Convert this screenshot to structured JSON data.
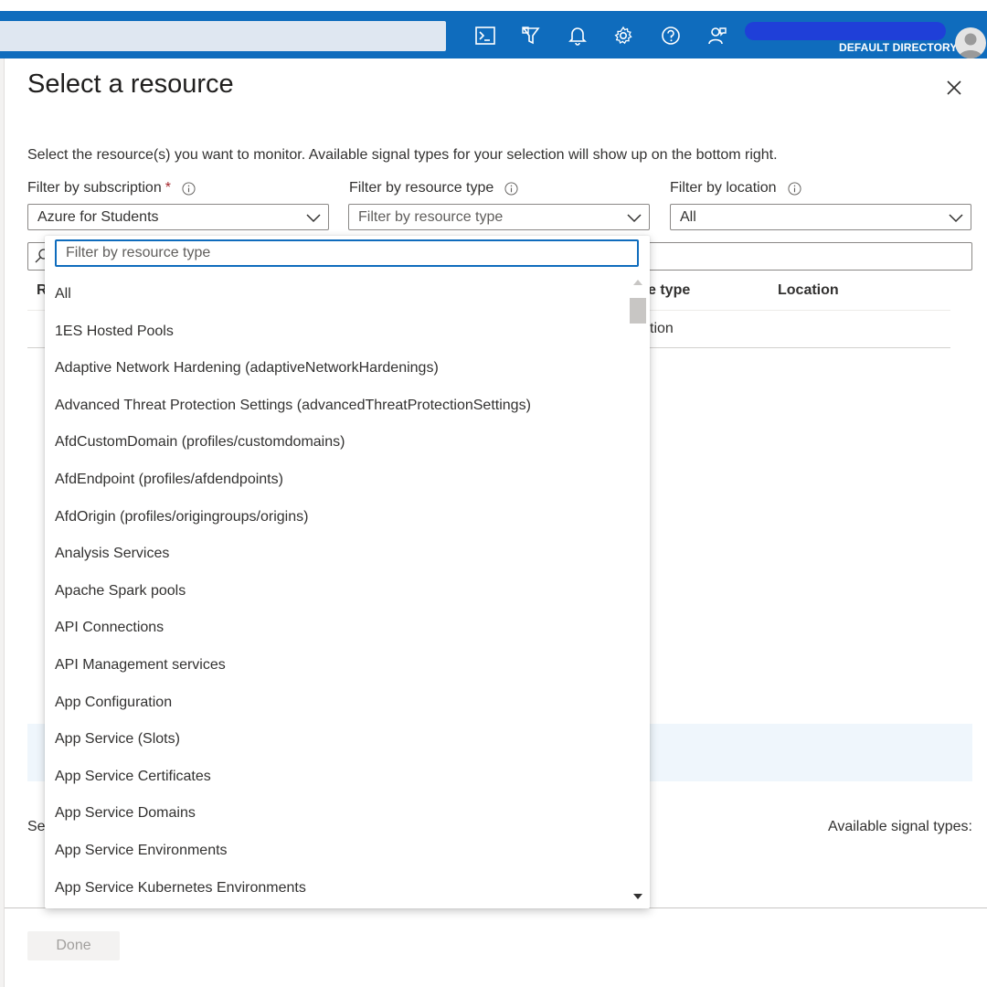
{
  "topbar": {
    "directory_label": "DEFAULT DIRECTORY",
    "icons": [
      "cloud-shell-icon",
      "directory-filter-icon",
      "notifications-icon",
      "settings-icon",
      "help-icon",
      "feedback-icon"
    ],
    "accent": "#0f6cbd"
  },
  "blade": {
    "title": "Select a resource",
    "description": "Select the resource(s) you want to monitor. Available signal types for your selection will show up on the bottom right."
  },
  "filters": {
    "subscription": {
      "label": "Filter by subscription",
      "required_mark": "*",
      "value": "Azure for Students"
    },
    "resource_type": {
      "label": "Filter by resource type",
      "placeholder": "Filter by resource type"
    },
    "location": {
      "label": "Filter by location",
      "value": "All"
    }
  },
  "table": {
    "headers": {
      "col1": "R",
      "type_partial": "e type",
      "location": "Location"
    },
    "row_partial": "tion"
  },
  "dropdown": {
    "search_placeholder": "Filter by resource type",
    "items": [
      "All",
      "1ES Hosted Pools",
      "Adaptive Network Hardening (adaptiveNetworkHardenings)",
      "Advanced Threat Protection Settings (advancedThreatProtectionSettings)",
      "AfdCustomDomain (profiles/customdomains)",
      "AfdEndpoint (profiles/afdendpoints)",
      "AfdOrigin (profiles/origingroups/origins)",
      "Analysis Services",
      "Apache Spark pools",
      "API Connections",
      "API Management services",
      "App Configuration",
      "App Service (Slots)",
      "App Service Certificates",
      "App Service Domains",
      "App Service Environments",
      "App Service Kubernetes Environments"
    ]
  },
  "bottom": {
    "selected_partial": "Sel",
    "signal_types_label": "Available signal types:"
  },
  "footer": {
    "done_label": "Done"
  }
}
